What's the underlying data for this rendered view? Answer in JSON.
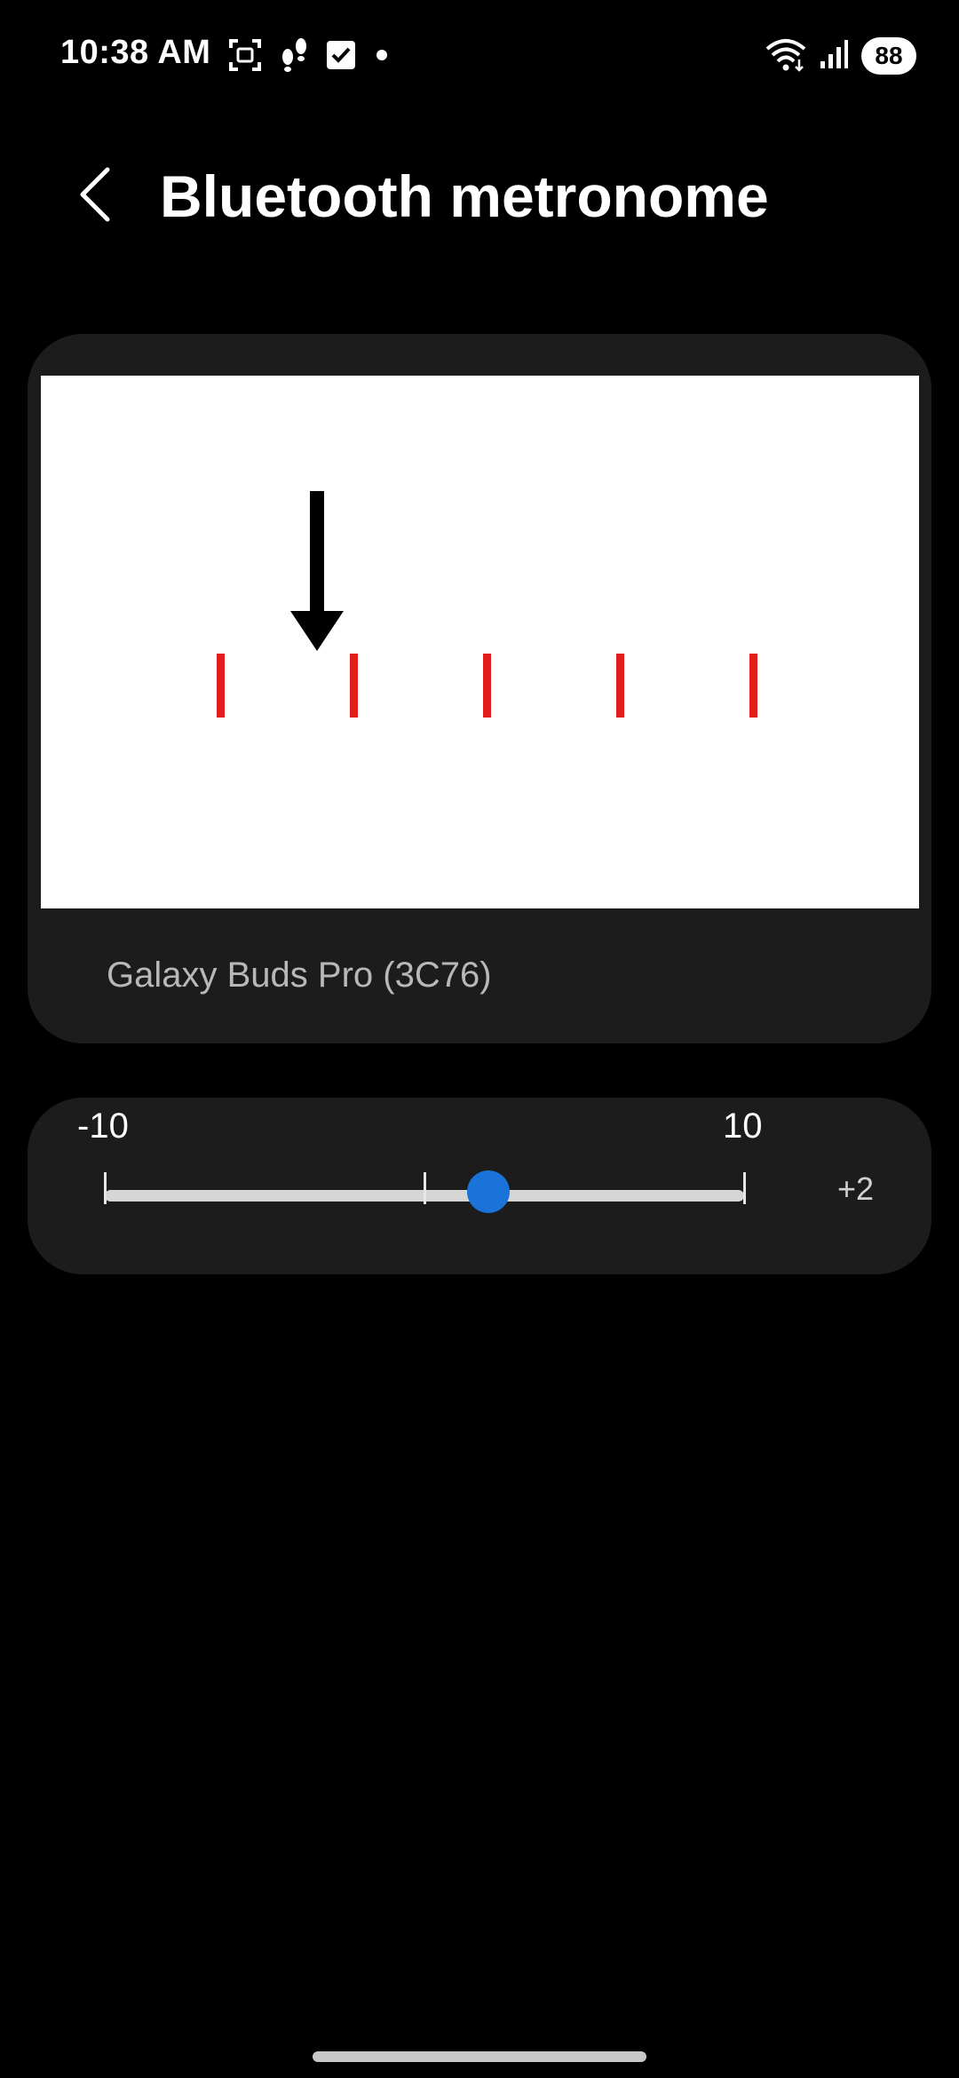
{
  "status_bar": {
    "time": "10:38 AM",
    "battery": "88",
    "left_icons": [
      "screenshot-icon",
      "steps-icon",
      "checkbox-icon",
      "dot-icon"
    ],
    "right_icons": [
      "wifi-icon",
      "signal-icon",
      "battery-icon"
    ]
  },
  "header": {
    "title": "Bluetooth metronome",
    "back_icon": "chevron-left-icon"
  },
  "preview": {
    "background": "#ffffff",
    "beat_color": "#e31b1b",
    "beat_count": 5,
    "arrow_icon": "arrow-down-icon",
    "device_name": "Galaxy Buds Pro (3C76)"
  },
  "offset_slider": {
    "min_label": "-10",
    "max_label": "10",
    "min": -10,
    "max": 10,
    "value": 2,
    "value_label": "+2",
    "accent": "#1a73d9"
  }
}
